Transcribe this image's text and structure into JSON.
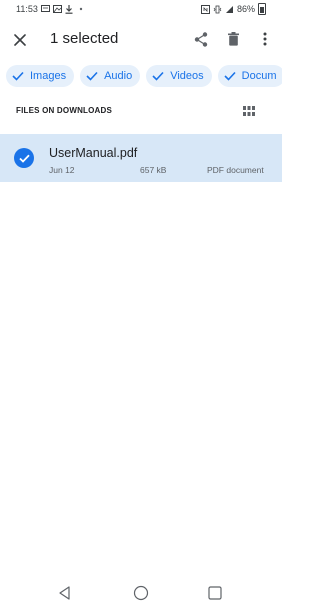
{
  "status_bar": {
    "time": "11:53",
    "battery": "86%",
    "icons": [
      "message-icon",
      "gallery-icon",
      "download-icon",
      "nfc-icon",
      "vibrate-icon",
      "wifi-icon",
      "signal-icon",
      "battery-icon"
    ]
  },
  "app_bar": {
    "title": "1 selected",
    "actions": [
      "close-icon",
      "share-icon",
      "delete-icon",
      "more-vert-icon"
    ]
  },
  "chips": [
    {
      "label": "Images"
    },
    {
      "label": "Audio"
    },
    {
      "label": "Videos"
    },
    {
      "label": "Docum"
    }
  ],
  "section": {
    "title": "FILES ON DOWNLOADS"
  },
  "files": [
    {
      "name": "UserManual.pdf",
      "date": "Jun 12",
      "size": "657 kB",
      "type": "PDF document",
      "selected": true
    }
  ],
  "colors": {
    "accent": "#1a73e8",
    "chip_bg": "#e6f0fb",
    "selected_row_bg": "#d7e7f7"
  }
}
